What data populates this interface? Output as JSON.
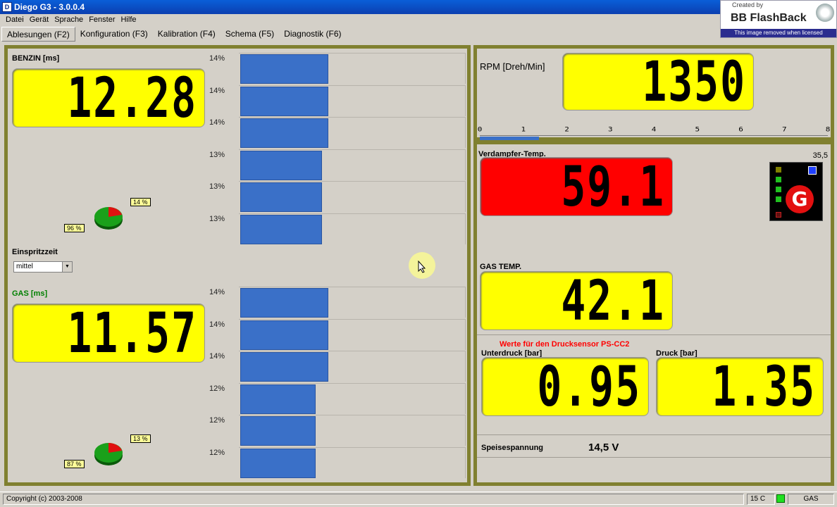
{
  "window": {
    "title": "Diego G3 - 3.0.0.4",
    "app_icon": "D"
  },
  "watermark": {
    "top": "Created by",
    "title": "BB FlashBack",
    "bottom": "This image removed when licensed"
  },
  "menu": [
    "Datei",
    "Gerät",
    "Sprache",
    "Fenster",
    "Hilfe"
  ],
  "tabs": [
    "Ablesungen (F2)",
    "Konfiguration (F3)",
    "Kalibration (F4)",
    "Schema (F5)",
    "Diagnostik (F6)"
  ],
  "active_tab": "Ablesungen (F2)",
  "benzin": {
    "label": "BENZIN [ms]",
    "value": "12.28",
    "bars": [
      {
        "label": "14%",
        "value": 14
      },
      {
        "label": "14%",
        "value": 14
      },
      {
        "label": "14%",
        "value": 14
      },
      {
        "label": "13%",
        "value": 13
      },
      {
        "label": "13%",
        "value": 13
      },
      {
        "label": "13%",
        "value": 13
      }
    ],
    "pie": {
      "big_label": "96 %",
      "small_label": "14 %"
    }
  },
  "einspritzzeit": {
    "label": "Einspritzzeit",
    "selected": "mittel"
  },
  "gas": {
    "label": "GAS [ms]",
    "value": "11.57",
    "bars": [
      {
        "label": "14%",
        "value": 14
      },
      {
        "label": "14%",
        "value": 14
      },
      {
        "label": "14%",
        "value": 14
      },
      {
        "label": "12%",
        "value": 12
      },
      {
        "label": "12%",
        "value": 12
      },
      {
        "label": "12%",
        "value": 12
      }
    ],
    "pie": {
      "big_label": "87 %",
      "small_label": "13 %"
    }
  },
  "rpm": {
    "label": "RPM [Dreh/Min]",
    "value": "1350",
    "scale": [
      "0",
      "1",
      "2",
      "3",
      "4",
      "5",
      "6",
      "7",
      "8"
    ],
    "level_fraction": 0.17
  },
  "verdampfer": {
    "label": "Verdampfer-Temp.",
    "value": "59.1",
    "corner_value": "35,5"
  },
  "gas_temp": {
    "label": "GAS TEMP.",
    "value": "42.1"
  },
  "pressure": {
    "title": "Werte für den Drucksensor PS-CC2",
    "unterdruck_label": "Unterdruck [bar]",
    "unterdruck_value": "0.95",
    "druck_label": "Druck [bar]",
    "druck_value": "1.35"
  },
  "supply": {
    "label": "Speisespannung",
    "value": "14,5 V"
  },
  "status": {
    "copyright": "Copyright (c) 2003-2008",
    "temp": "15 C",
    "mode": "GAS"
  },
  "colors": {
    "panel_border": "#808030",
    "lcd_yellow": "#ffff00",
    "lcd_red": "#ff0000",
    "bar_blue": "#3a70c8",
    "gas_label": "#008000",
    "pressure_title": "#ff0000"
  }
}
